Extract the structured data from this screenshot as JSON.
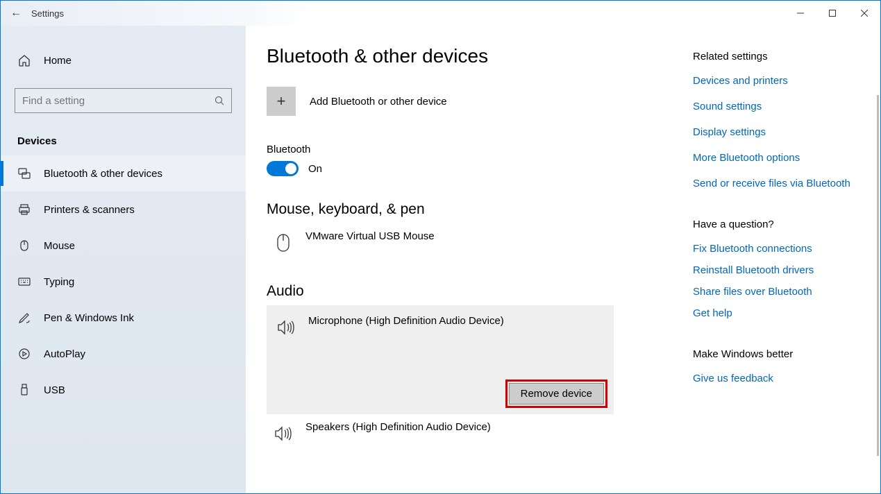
{
  "window": {
    "title": "Settings"
  },
  "sidebar": {
    "home": "Home",
    "search_placeholder": "Find a setting",
    "section": "Devices",
    "items": [
      {
        "label": "Bluetooth & other devices"
      },
      {
        "label": "Printers & scanners"
      },
      {
        "label": "Mouse"
      },
      {
        "label": "Typing"
      },
      {
        "label": "Pen & Windows Ink"
      },
      {
        "label": "AutoPlay"
      },
      {
        "label": "USB"
      }
    ]
  },
  "page": {
    "title": "Bluetooth & other devices",
    "add_label": "Add Bluetooth or other device",
    "bluetooth": {
      "label": "Bluetooth",
      "state": "On"
    },
    "groups": {
      "mouse": {
        "title": "Mouse, keyboard, & pen",
        "device": "VMware Virtual USB Mouse"
      },
      "audio": {
        "title": "Audio",
        "device_selected": "Microphone (High Definition Audio Device)",
        "remove_label": "Remove device",
        "device_other": "Speakers (High Definition Audio Device)"
      }
    }
  },
  "side": {
    "related": {
      "title": "Related settings",
      "links": [
        "Devices and printers",
        "Sound settings",
        "Display settings",
        "More Bluetooth options",
        "Send or receive files via Bluetooth"
      ]
    },
    "question": {
      "title": "Have a question?",
      "links": [
        "Fix Bluetooth connections",
        "Reinstall Bluetooth drivers",
        "Share files over Bluetooth",
        "Get help"
      ]
    },
    "feedback": {
      "title": "Make Windows better",
      "links": [
        "Give us feedback"
      ]
    }
  }
}
